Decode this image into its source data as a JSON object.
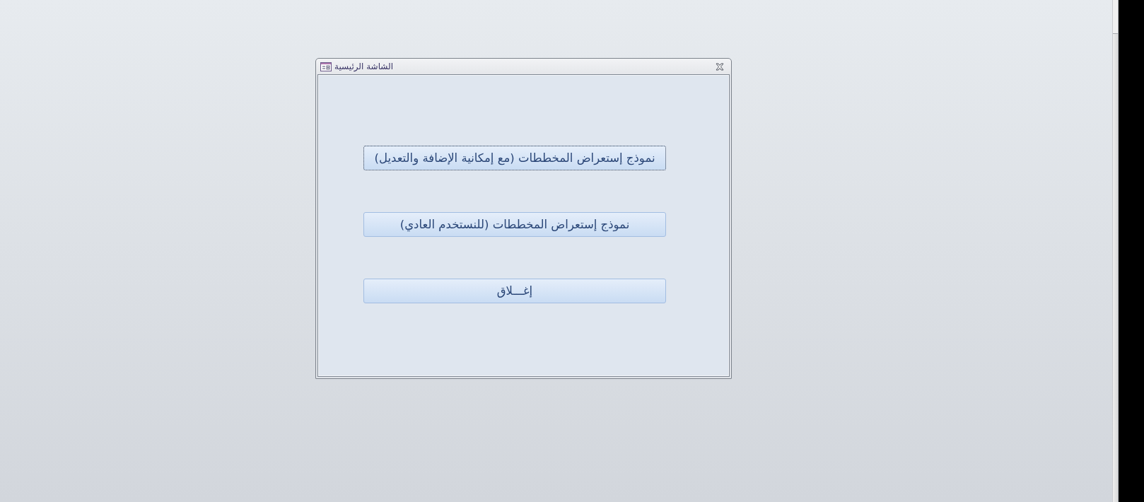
{
  "window": {
    "title": "الشاشة الرئيسية"
  },
  "buttons": [
    {
      "label": "نموذج إستعراض المخططات (مع إمكانية الإضافة والتعديل)",
      "focused": true
    },
    {
      "label": "نموذج إستعراض المخططات (للنستخدم العادي)",
      "focused": false
    },
    {
      "label": "إغـــلاق",
      "focused": false
    }
  ]
}
